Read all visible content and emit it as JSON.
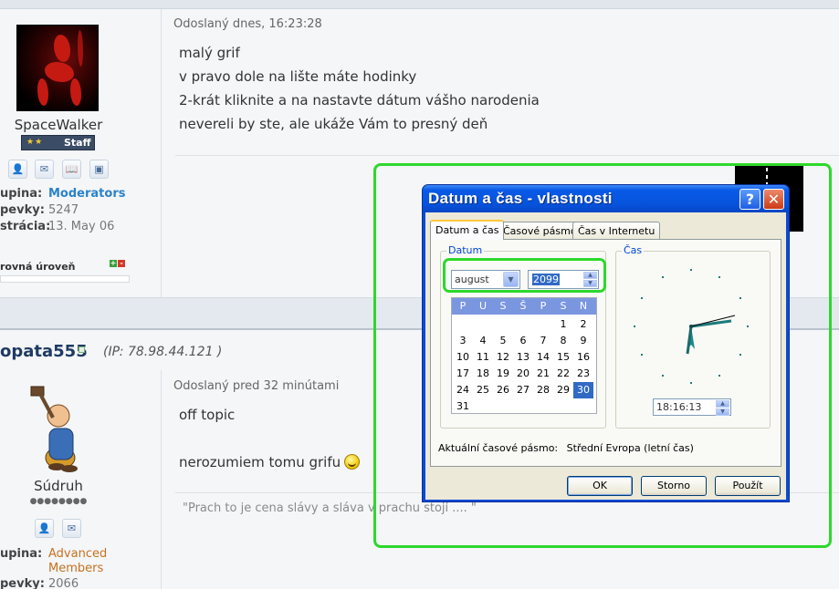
{
  "post1": {
    "username": "SpaceWalker",
    "rank": "Staff",
    "rank_stars": "★★",
    "group_label": "upina:",
    "group_value": "Moderators",
    "posts_label": "pevky:",
    "posts_value": "5247",
    "reg_label": "strácia:",
    "reg_value": "13. May 06",
    "reputation_label": "rovná úroveň",
    "posted_at": "Odoslaný dnes, 16:23:28",
    "lines": [
      "malý grif",
      "v pravo dole na lište máte hodinky",
      "2-krát kliknite a na nastavte dátum vášho narodenia",
      "nevereli by ste, ale ukáže Vám to presný deň"
    ]
  },
  "post2": {
    "username": "opata555",
    "ip": "(IP: 78.98.44.121 )",
    "title": "Súdruh",
    "rank_dots": "●●●●●●●●",
    "group_label": "upina:",
    "group_value": "Advanced Members",
    "posts_label": "pevky:",
    "posts_value": "2066",
    "posted_at": "Odoslaný pred 32 minútami",
    "line1": "off topic",
    "line2": "nerozumiem tomu grifu",
    "signature": "\"Prach to je cena slávy a sláva v prachu stojí .... \""
  },
  "dialog": {
    "title": "Datum a čas - vlastnosti",
    "help_glyph": "?",
    "close_glyph": "✕",
    "tabs": [
      "Datum a čas",
      "Časové pásmo",
      "Čas v Internetu"
    ],
    "date_group": "Datum",
    "time_group": "Čas",
    "month": "august",
    "year": "2099",
    "weekdays": [
      "P",
      "U",
      "S",
      "Š",
      "P",
      "S",
      "N"
    ],
    "days_first_row": [
      "1",
      "2"
    ],
    "days": [
      "3",
      "4",
      "5",
      "6",
      "7",
      "8",
      "9",
      "10",
      "11",
      "12",
      "13",
      "14",
      "15",
      "16",
      "17",
      "18",
      "19",
      "20",
      "21",
      "22",
      "23",
      "24",
      "25",
      "26",
      "27",
      "28",
      "29",
      "30",
      "31"
    ],
    "selected_day": "30",
    "time": "18:16:13",
    "tz_label": "Aktuální časové pásmo:",
    "tz_value": "Střední Evropa (letní čas)",
    "btn_ok": "OK",
    "btn_cancel": "Storno",
    "btn_apply": "Použít"
  },
  "colors": {
    "frame_green": "#2dd82d",
    "moderators": "#2b82c9",
    "advanced": "#c8711f"
  }
}
